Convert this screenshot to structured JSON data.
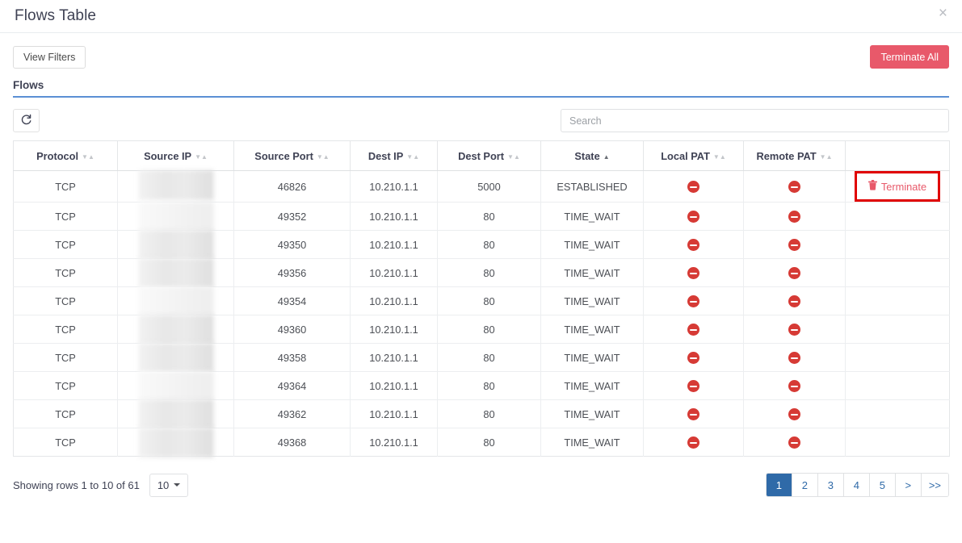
{
  "window": {
    "title": "Flows Table",
    "close_label": "×"
  },
  "toolbar": {
    "view_filters_label": "View Filters",
    "terminate_all_label": "Terminate All"
  },
  "tab": {
    "label": "Flows"
  },
  "controls": {
    "refresh_icon": "refresh-icon",
    "search_placeholder": "Search",
    "search_value": ""
  },
  "table": {
    "columns": [
      {
        "label": "Protocol",
        "sortable": true,
        "sorted": false
      },
      {
        "label": "Source IP",
        "sortable": true,
        "sorted": false
      },
      {
        "label": "Source Port",
        "sortable": true,
        "sorted": false
      },
      {
        "label": "Dest IP",
        "sortable": true,
        "sorted": false
      },
      {
        "label": "Dest Port",
        "sortable": true,
        "sorted": false
      },
      {
        "label": "State",
        "sortable": true,
        "sorted": "asc"
      },
      {
        "label": "Local PAT",
        "sortable": true,
        "sorted": false
      },
      {
        "label": "Remote PAT",
        "sortable": true,
        "sorted": false
      },
      {
        "label": "",
        "sortable": false,
        "sorted": false
      }
    ],
    "rows": [
      {
        "protocol": "TCP",
        "source_ip": "",
        "source_ip_redacted": true,
        "source_port": "46826",
        "dest_ip": "10.210.1.1",
        "dest_port": "5000",
        "state": "ESTABLISHED",
        "local_pat": "blocked",
        "remote_pat": "blocked",
        "action": "Terminate",
        "action_visible": true,
        "highlighted": true
      },
      {
        "protocol": "TCP",
        "source_ip": "",
        "source_ip_redacted": true,
        "source_port": "49352",
        "dest_ip": "10.210.1.1",
        "dest_port": "80",
        "state": "TIME_WAIT",
        "local_pat": "blocked",
        "remote_pat": "blocked",
        "action": "",
        "action_visible": false,
        "highlighted": false
      },
      {
        "protocol": "TCP",
        "source_ip": "",
        "source_ip_redacted": true,
        "source_port": "49350",
        "dest_ip": "10.210.1.1",
        "dest_port": "80",
        "state": "TIME_WAIT",
        "local_pat": "blocked",
        "remote_pat": "blocked",
        "action": "",
        "action_visible": false,
        "highlighted": false
      },
      {
        "protocol": "TCP",
        "source_ip": "",
        "source_ip_redacted": true,
        "source_port": "49356",
        "dest_ip": "10.210.1.1",
        "dest_port": "80",
        "state": "TIME_WAIT",
        "local_pat": "blocked",
        "remote_pat": "blocked",
        "action": "",
        "action_visible": false,
        "highlighted": false
      },
      {
        "protocol": "TCP",
        "source_ip": "",
        "source_ip_redacted": true,
        "source_port": "49354",
        "dest_ip": "10.210.1.1",
        "dest_port": "80",
        "state": "TIME_WAIT",
        "local_pat": "blocked",
        "remote_pat": "blocked",
        "action": "",
        "action_visible": false,
        "highlighted": false
      },
      {
        "protocol": "TCP",
        "source_ip": "",
        "source_ip_redacted": true,
        "source_port": "49360",
        "dest_ip": "10.210.1.1",
        "dest_port": "80",
        "state": "TIME_WAIT",
        "local_pat": "blocked",
        "remote_pat": "blocked",
        "action": "",
        "action_visible": false,
        "highlighted": false
      },
      {
        "protocol": "TCP",
        "source_ip": "",
        "source_ip_redacted": true,
        "source_port": "49358",
        "dest_ip": "10.210.1.1",
        "dest_port": "80",
        "state": "TIME_WAIT",
        "local_pat": "blocked",
        "remote_pat": "blocked",
        "action": "",
        "action_visible": false,
        "highlighted": false
      },
      {
        "protocol": "TCP",
        "source_ip": "",
        "source_ip_redacted": true,
        "source_port": "49364",
        "dest_ip": "10.210.1.1",
        "dest_port": "80",
        "state": "TIME_WAIT",
        "local_pat": "blocked",
        "remote_pat": "blocked",
        "action": "",
        "action_visible": false,
        "highlighted": false
      },
      {
        "protocol": "TCP",
        "source_ip": "",
        "source_ip_redacted": true,
        "source_port": "49362",
        "dest_ip": "10.210.1.1",
        "dest_port": "80",
        "state": "TIME_WAIT",
        "local_pat": "blocked",
        "remote_pat": "blocked",
        "action": "",
        "action_visible": false,
        "highlighted": false
      },
      {
        "protocol": "TCP",
        "source_ip": "",
        "source_ip_redacted": true,
        "source_port": "49368",
        "dest_ip": "10.210.1.1",
        "dest_port": "80",
        "state": "TIME_WAIT",
        "local_pat": "blocked",
        "remote_pat": "blocked",
        "action": "",
        "action_visible": false,
        "highlighted": false
      }
    ]
  },
  "footer": {
    "rows_info": "Showing rows 1 to 10 of 61",
    "page_size": "10",
    "pages": [
      {
        "label": "1",
        "active": true
      },
      {
        "label": "2",
        "active": false
      },
      {
        "label": "3",
        "active": false
      },
      {
        "label": "4",
        "active": false
      },
      {
        "label": "5",
        "active": false
      },
      {
        "label": ">",
        "active": false
      },
      {
        "label": ">>",
        "active": false
      }
    ]
  },
  "colors": {
    "accent_blue": "#2f6aa8",
    "tab_underline": "#5b8fd4",
    "danger": "#e8596a",
    "ban_red": "#d63a35",
    "highlight_red": "#e00000"
  }
}
